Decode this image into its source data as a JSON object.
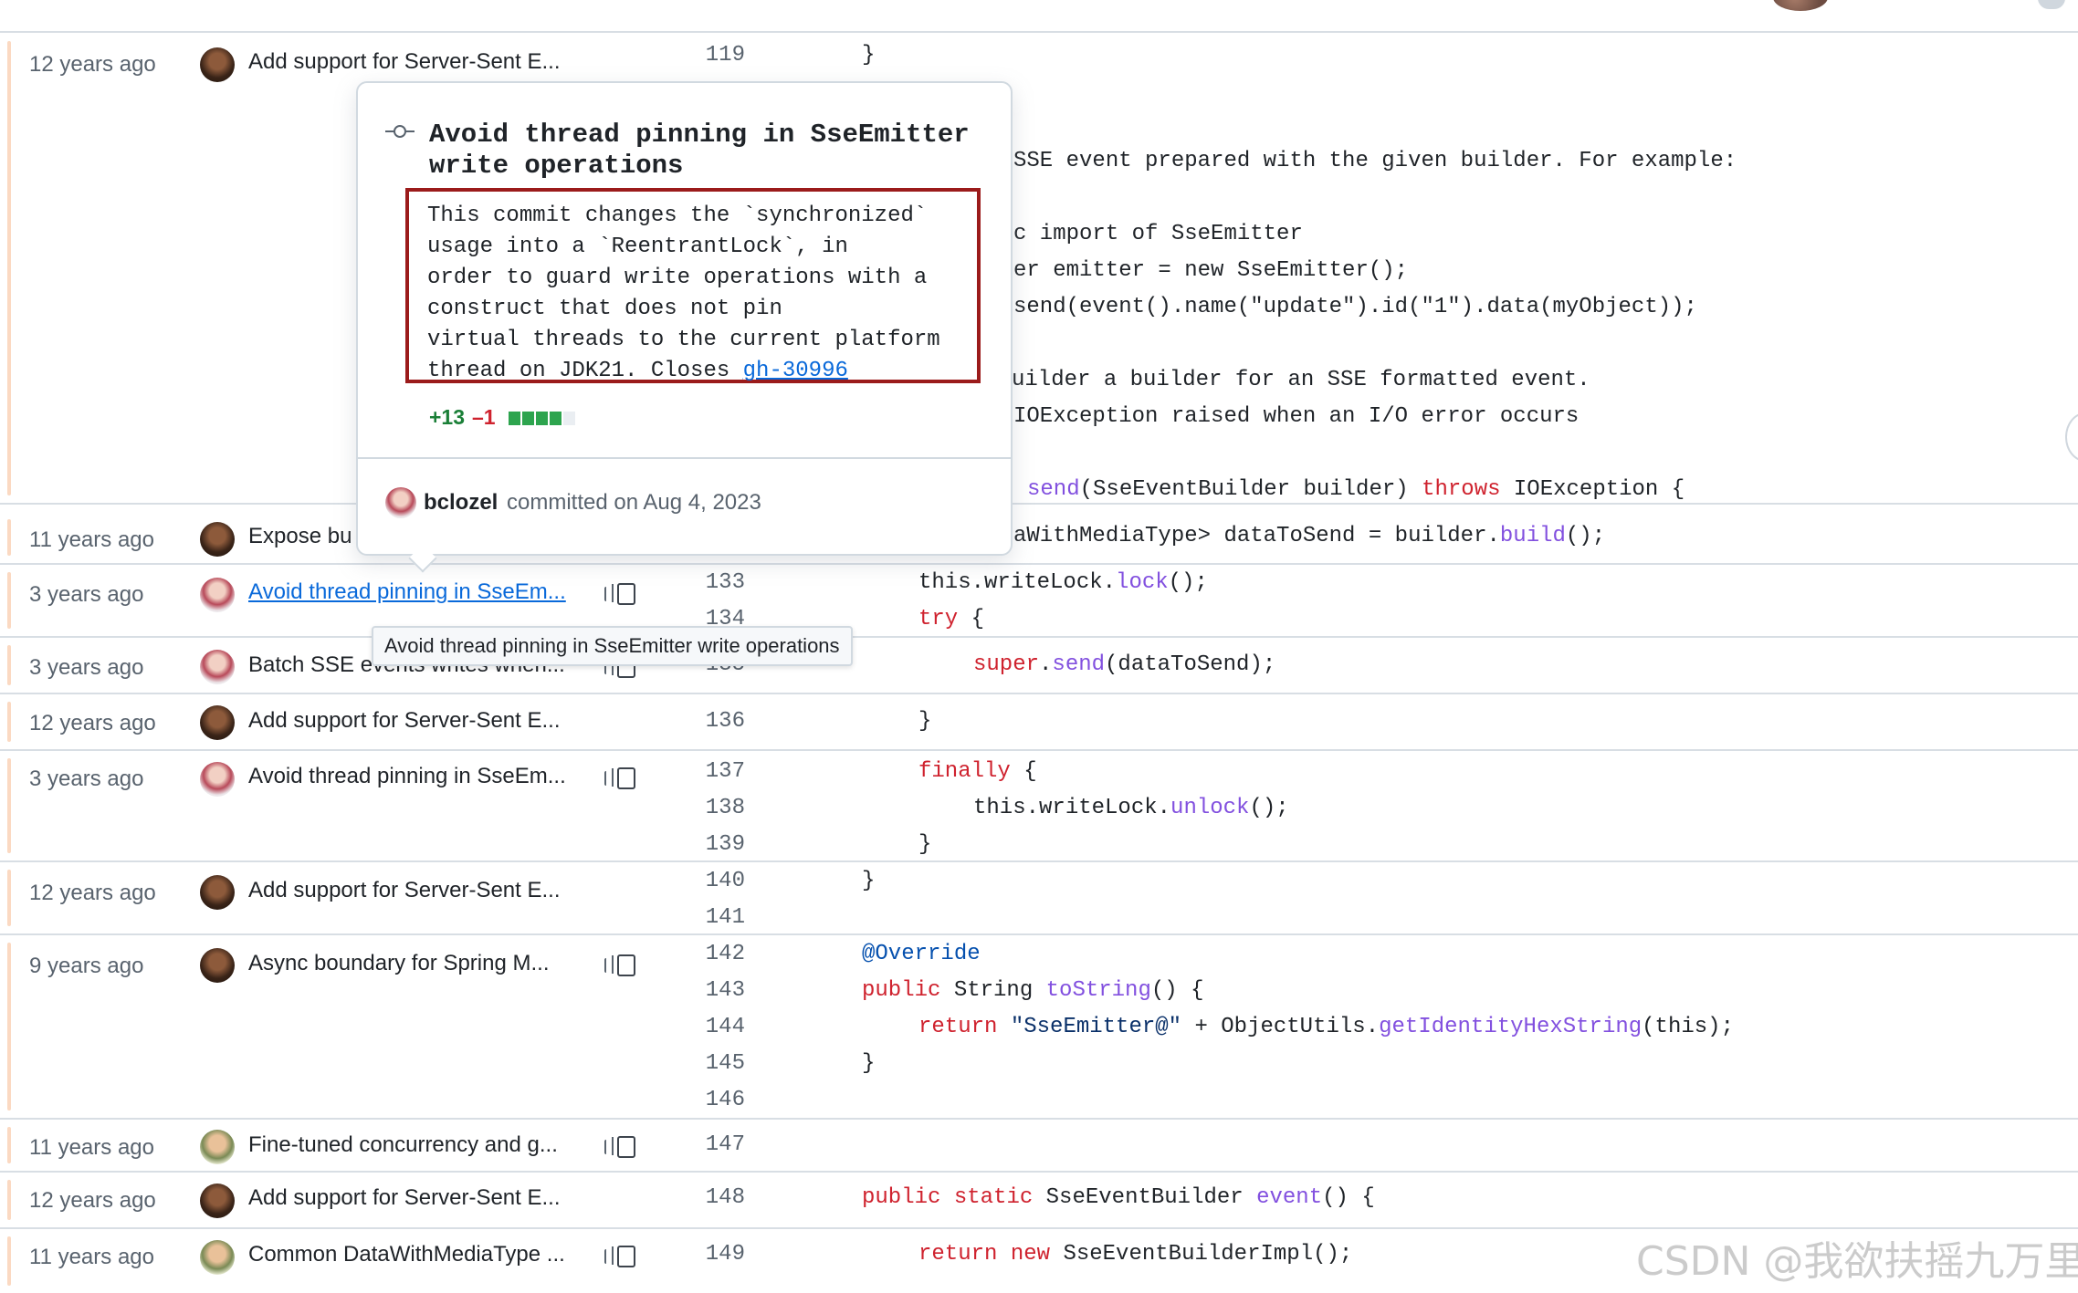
{
  "groups": [
    {
      "age": "12 years ago",
      "message": "Add support for Server-Sent E...",
      "avatar": "avatar-dark",
      "reblame": false
    },
    {
      "age": "11 years ago",
      "message": "Expose bu",
      "avatar": "avatar-dark",
      "reblame": false
    },
    {
      "age": "3 years ago",
      "message": "Avoid thread pinning in SseEm...",
      "avatar": "avatar-pink",
      "reblame": true,
      "hovered": true
    },
    {
      "age": "3 years ago",
      "message": "Batch SSE events writes when...",
      "avatar": "avatar-pink",
      "reblame": true
    },
    {
      "age": "12 years ago",
      "message": "Add support for Server-Sent E...",
      "avatar": "avatar-dark",
      "reblame": false
    },
    {
      "age": "3 years ago",
      "message": "Avoid thread pinning in SseEm...",
      "avatar": "avatar-pink",
      "reblame": true
    },
    {
      "age": "12 years ago",
      "message": "Add support for Server-Sent E...",
      "avatar": "avatar-dark",
      "reblame": false
    },
    {
      "age": "9 years ago",
      "message": "Async boundary for Spring M...",
      "avatar": "avatar-dark",
      "reblame": true
    },
    {
      "age": "11 years ago",
      "message": "Fine-tuned concurrency and g...",
      "avatar": "avatar-yellow",
      "reblame": true
    },
    {
      "age": "12 years ago",
      "message": "Add support for Server-Sent E...",
      "avatar": "avatar-dark",
      "reblame": false
    },
    {
      "age": "11 years ago",
      "message": "Common DataWithMediaType ...",
      "avatar": "avatar-yellow",
      "reblame": true
    }
  ],
  "line_numbers": [
    "119",
    "133",
    "134",
    "135",
    "136",
    "137",
    "138",
    "139",
    "140",
    "141",
    "142",
    "143",
    "144",
    "145",
    "146",
    "147",
    "148",
    "149"
  ],
  "code_lines": [
    "}",
    "SSE event prepared with the given builder. For example:",
    "c import of SseEmitter",
    "er emitter = new SseEmitter();",
    "send(event().name(\"update\").id(\"1\").data(myObject));",
    "uilder a builder for an SSE formatted event.",
    "IOException raised when an I/O error occurs",
    "send(SseEventBuilder builder) throws IOException {",
    "aWithMediaType> dataToSend = builder.build();",
    "this.writeLock.lock();",
    "try {",
    "super.send(dataToSend);",
    "}",
    "finally {",
    "this.writeLock.unlock();",
    "}",
    "}",
    "@Override",
    "public String toString() {",
    "return \"SseEmitter@\" + ObjectUtils.getIdentityHexString(this);",
    "}",
    "public static SseEventBuilder event() {",
    "return new SseEventBuilderImpl();"
  ],
  "popover": {
    "title": "Avoid thread pinning in SseEmitter write operations",
    "body_lines": [
      "This commit changes the `synchronized`",
      "usage into a `ReentrantLock`, in",
      "order to guard write operations with a",
      "construct that does not pin",
      "virtual threads to the current platform",
      "thread on JDK21. Closes "
    ],
    "issue_link": "gh-30996",
    "additions": "+13",
    "deletions": "–1",
    "diff_squares": [
      "#2da44e",
      "#2da44e",
      "#2da44e",
      "#2da44e",
      "#eaeef2"
    ],
    "author": "bclozel",
    "committed": "committed on Aug 4, 2023"
  },
  "tooltip": "Avoid thread pinning in SseEmitter write operations",
  "watermark": "CSDN @我欲扶摇九万里",
  "colors": {
    "age_bar": "#fbd9c2",
    "keyword": "#cf222e",
    "function": "#8250df",
    "link": "#0969da",
    "popover_body_border": "#9b1b1b"
  }
}
